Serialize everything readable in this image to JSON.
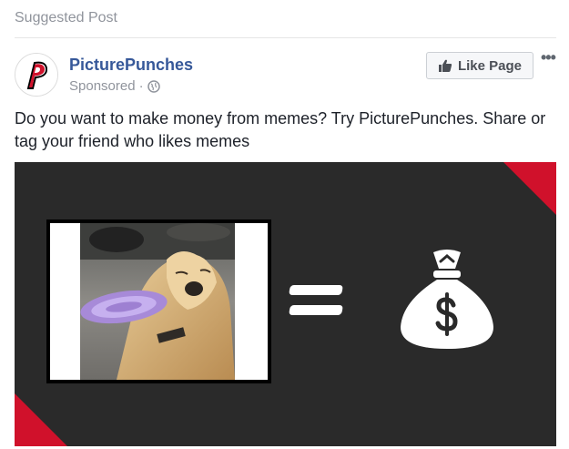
{
  "header": {
    "label": "Suggested Post"
  },
  "page": {
    "name": "PicturePunches",
    "sponsored": "Sponsored",
    "separator": "·"
  },
  "actions": {
    "like_page": "Like Page",
    "more": "•••"
  },
  "post": {
    "text": "Do you want to make money from memes? Try PicturePunches. Share or tag your friend who likes memes"
  },
  "colors": {
    "link_blue": "#365899",
    "brand_red": "#d0112b",
    "ad_background": "#2a2a2a"
  },
  "icons": {
    "avatar": "picturepunches-p-logo",
    "privacy": "globe-icon",
    "like": "thumbs-up-icon",
    "reward": "money-bag-icon"
  }
}
